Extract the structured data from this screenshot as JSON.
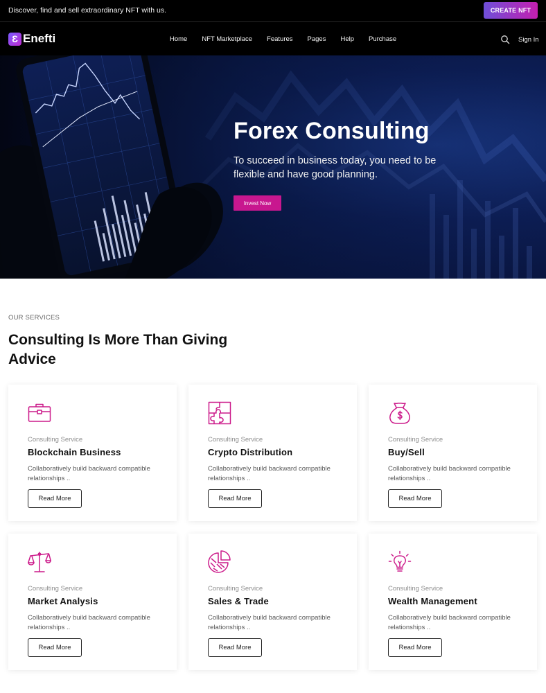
{
  "topbar": {
    "text": "Discover, find and sell extraordinary NFT with us.",
    "cta_label": "CREATE NFT"
  },
  "nav": {
    "logo_mark": "Ɛ",
    "logo_text": "Enefti",
    "links": [
      "Home",
      "NFT Marketplace",
      "Features",
      "Pages",
      "Help",
      "Purchase"
    ],
    "search_icon": "search-icon",
    "signin_label": "Sign In"
  },
  "hero": {
    "title": "Forex Consulting",
    "subtitle": "To succeed in business today, you need to be flexible and have good planning.",
    "button_label": "Invest Now"
  },
  "services": {
    "eyebrow": "OUR SERVICES",
    "title": "Consulting Is More Than Giving Advice",
    "cards": [
      {
        "icon": "briefcase-icon",
        "kicker": "Consulting Service",
        "title": "Blockchain Business",
        "desc": "Collaboratively build backward compatible relationships ..",
        "button": "Read More"
      },
      {
        "icon": "puzzle-icon",
        "kicker": "Consulting Service",
        "title": "Crypto Distribution",
        "desc": "Collaboratively build backward compatible relationships ..",
        "button": "Read More"
      },
      {
        "icon": "money-bag-icon",
        "kicker": "Consulting Service",
        "title": "Buy/Sell",
        "desc": "Collaboratively build backward compatible relationships ..",
        "button": "Read More"
      },
      {
        "icon": "balance-scale-icon",
        "kicker": "Consulting Service",
        "title": "Market Analysis",
        "desc": "Collaboratively build backward compatible relationships ..",
        "button": "Read More"
      },
      {
        "icon": "pie-chart-icon",
        "kicker": "Consulting Service",
        "title": "Sales & Trade",
        "desc": "Collaboratively build backward compatible relationships ..",
        "button": "Read More"
      },
      {
        "icon": "lightbulb-icon",
        "kicker": "Consulting Service",
        "title": "Wealth Management",
        "desc": "Collaboratively build backward compatible relationships ..",
        "button": "Read More"
      }
    ]
  },
  "colors": {
    "accent": "#c8178f",
    "icon": "#cc1a8a",
    "gradient_start": "#6e4fd8",
    "gradient_end": "#c41fb0",
    "hero_bg": "#0d1e54"
  }
}
